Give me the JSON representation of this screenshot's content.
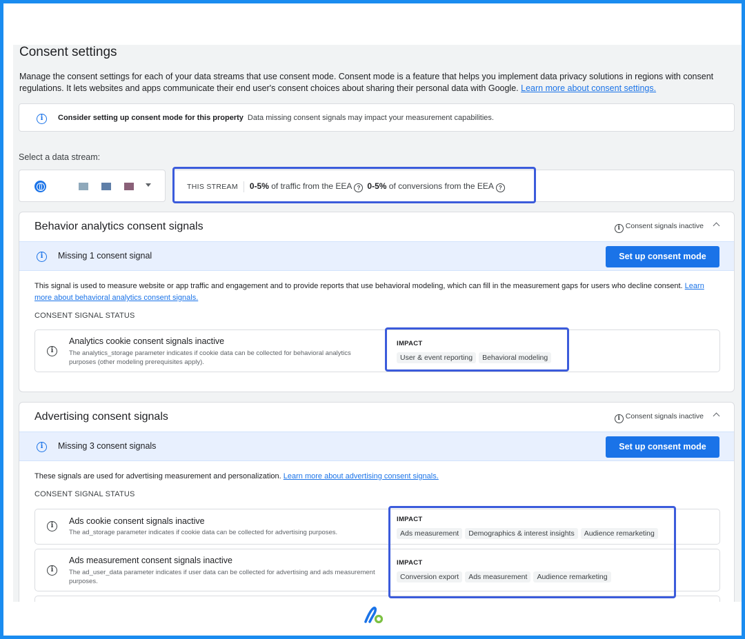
{
  "page": {
    "title": "Consent settings",
    "description": "Manage the consent settings for each of your data streams that use consent mode. Consent mode is a feature that helps you implement data privacy solutions in regions with consent regulations. It lets websites and apps communicate their end user's consent choices about sharing their personal data with Google.",
    "learn_more": "Learn more about consent settings."
  },
  "banner": {
    "bold": "Consider setting up consent mode for this property",
    "text": "Data missing consent signals may impact your measurement capabilities."
  },
  "stream": {
    "label": "Select a data stream:",
    "swatch_colors": [
      "#8fa9bb",
      "#5f7fa8",
      "#8a6078"
    ],
    "this_stream": "THIS STREAM",
    "traffic_value": "0-5%",
    "traffic_text": "of traffic from the EEA",
    "conv_value": "0-5%",
    "conv_text": "of conversions from the EEA"
  },
  "behavior": {
    "title": "Behavior analytics consent signals",
    "status": "Consent signals inactive",
    "missing": "Missing 1 consent signal",
    "button": "Set up consent mode",
    "desc": "This signal is used to measure website or app traffic and engagement and to provide reports that use behavioral modeling, which can fill in the measurement gaps for users who decline consent.",
    "learn_more": "Learn more about behavioral analytics consent signals.",
    "status_caption": "CONSENT SIGNAL STATUS",
    "signals": [
      {
        "title": "Analytics cookie consent signals inactive",
        "desc": "The analytics_storage parameter indicates if cookie data can be collected for behavioral analytics purposes (other modeling prerequisites apply).",
        "impact": "IMPACT",
        "chips": [
          "User & event reporting",
          "Behavioral modeling"
        ]
      }
    ]
  },
  "advertising": {
    "title": "Advertising consent signals",
    "status": "Consent signals inactive",
    "missing": "Missing 3 consent signals",
    "button": "Set up consent mode",
    "desc": "These signals are used for advertising measurement and personalization.",
    "learn_more": "Learn more about advertising consent signals.",
    "status_caption": "CONSENT SIGNAL STATUS",
    "signals": [
      {
        "title": "Ads cookie consent signals inactive",
        "desc": "The ad_storage parameter indicates if cookie data can be collected for advertising purposes.",
        "impact": "IMPACT",
        "chips": [
          "Ads measurement",
          "Demographics & interest insights",
          "Audience remarketing"
        ]
      },
      {
        "title": "Ads measurement consent signals inactive",
        "desc": "The ad_user_data parameter indicates if user data can be collected for advertising and ads measurement purposes.",
        "impact": "IMPACT",
        "chips": [
          "Conversion export",
          "Ads measurement",
          "Audience remarketing"
        ]
      }
    ]
  },
  "colors": {
    "frame": "#1a8cf0",
    "highlight": "#3b5bdb",
    "primary": "#1a73e8"
  }
}
